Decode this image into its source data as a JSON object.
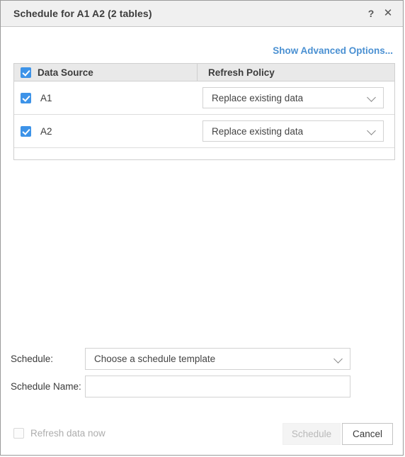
{
  "dialog": {
    "title": "Schedule for A1 A2 (2 tables)",
    "help_icon": "question-mark-icon",
    "close_icon": "close-icon"
  },
  "advanced": {
    "link_label": "Show Advanced Options...",
    "link_color": "#4a90d2"
  },
  "table": {
    "columns": [
      "Data Source",
      "Refresh Policy"
    ],
    "header_checkbox_checked": true,
    "rows": [
      {
        "checked": true,
        "source": "A1",
        "refresh_policy": "Replace existing data"
      },
      {
        "checked": true,
        "source": "A2",
        "refresh_policy": "Replace existing data"
      }
    ]
  },
  "form": {
    "schedule_label": "Schedule:",
    "schedule_value": "Choose a schedule template",
    "schedule_name_label": "Schedule Name:",
    "schedule_name_value": "",
    "schedule_name_placeholder": ""
  },
  "footer": {
    "refresh_now_label": "Refresh data now",
    "refresh_now_checked": false,
    "refresh_now_disabled": true,
    "schedule_button": "Schedule",
    "schedule_button_disabled": true,
    "cancel_button": "Cancel"
  },
  "theme": {
    "accent": "#3d93e8",
    "titlebar_bg": "#f0f0f0",
    "header_bg": "#e9e9e9"
  }
}
